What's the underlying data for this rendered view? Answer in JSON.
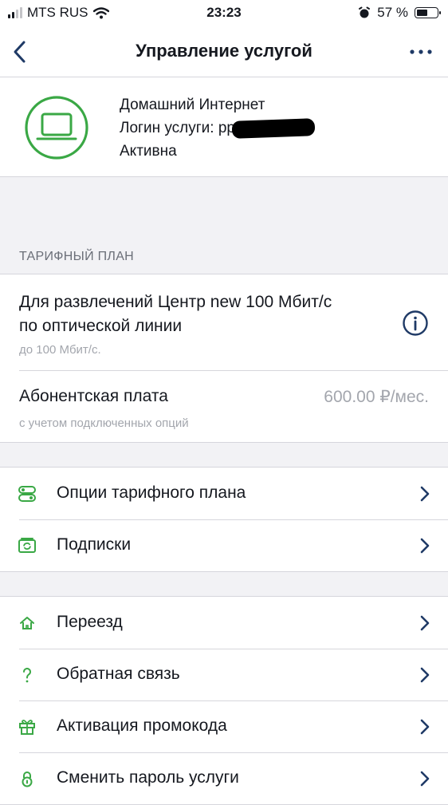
{
  "status_bar": {
    "carrier": "MTS RUS",
    "time": "23:23",
    "battery_percent": "57 %",
    "battery_level": 0.57
  },
  "header": {
    "title": "Управление услугой"
  },
  "service": {
    "name": "Домашний Интернет",
    "login_label": "Логин услуги: рррое",
    "status": "Активна"
  },
  "tariff": {
    "section_title": "ТАРИФНЫЙ ПЛАН",
    "name": "Для развлечений Центр new 100 Мбит/с по оптической линии",
    "speed": "до 100 Мбит/с.",
    "fee_label": "Абонентская плата",
    "fee_value": "600.00 ₽/мес.",
    "fee_note": "с учетом подключенных опций"
  },
  "menu_group_1": [
    {
      "label": "Опции тарифного плана",
      "icon": "toggles-icon"
    },
    {
      "label": "Подписки",
      "icon": "subscriptions-icon"
    }
  ],
  "menu_group_2": [
    {
      "label": "Переезд",
      "icon": "home-icon"
    },
    {
      "label": "Обратная связь",
      "icon": "question-icon"
    },
    {
      "label": "Активация промокода",
      "icon": "gift-icon"
    },
    {
      "label": "Сменить пароль услуги",
      "icon": "lock-icon"
    }
  ],
  "colors": {
    "accent_green": "#3aa845",
    "nav_blue": "#1f3a66",
    "text": "#15181f",
    "muted": "#a3a6ad",
    "background": "#f2f2f5"
  }
}
